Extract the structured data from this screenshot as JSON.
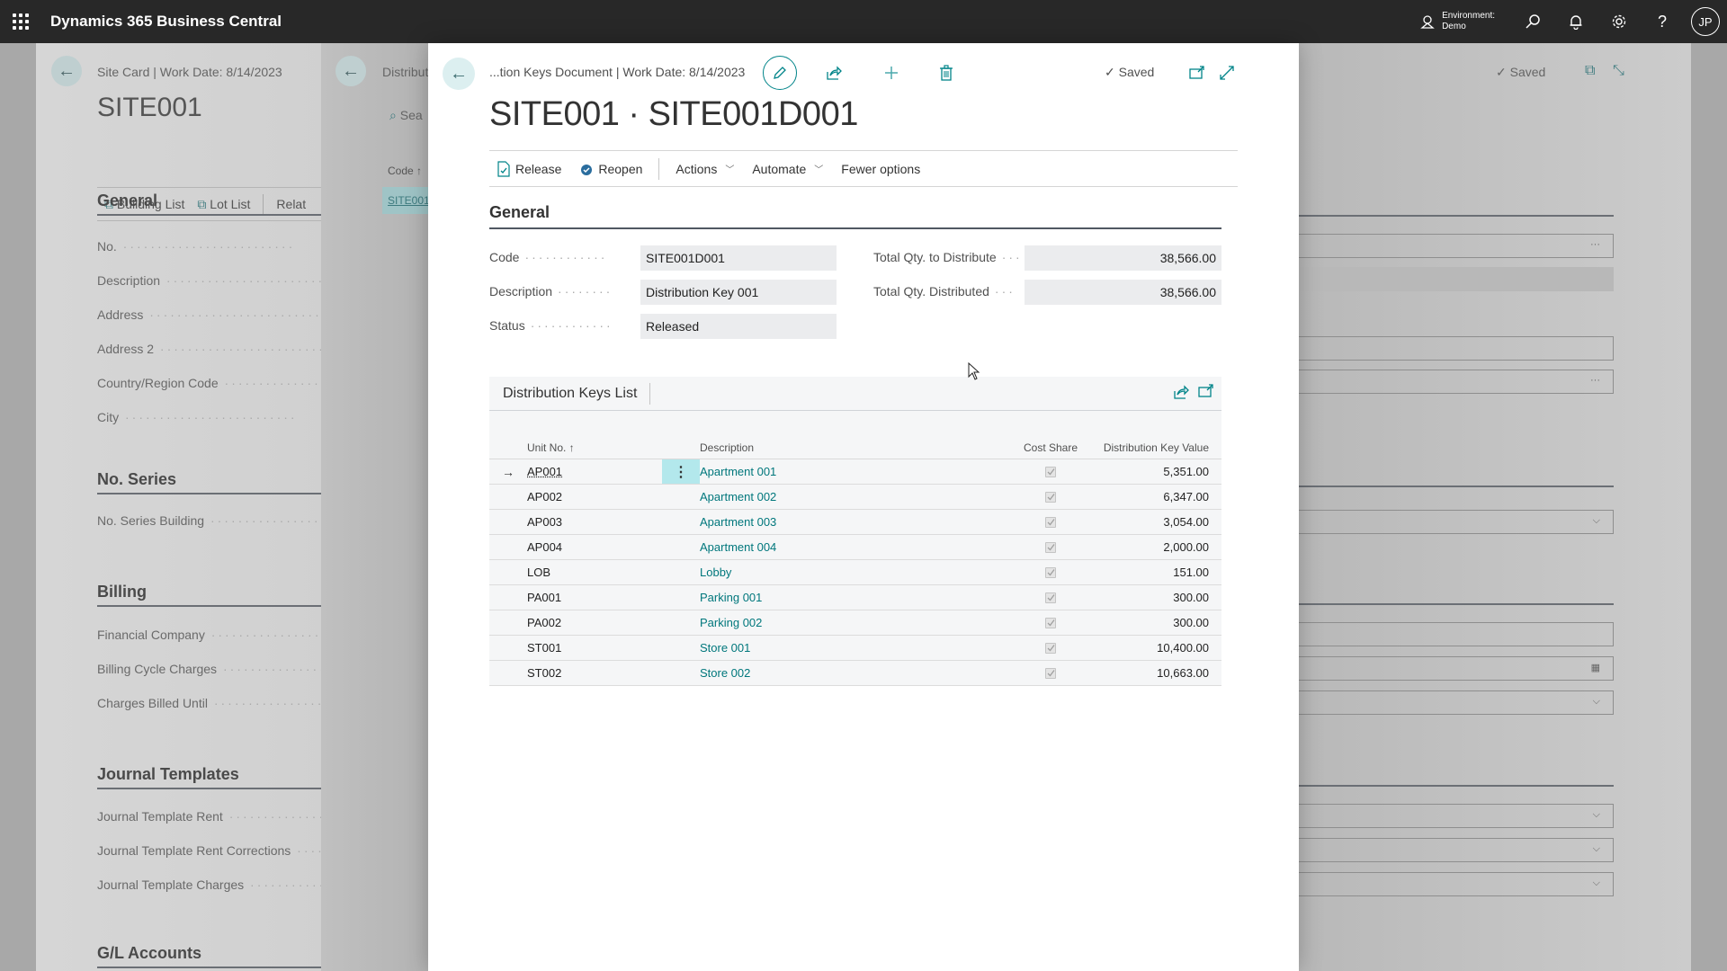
{
  "topbar": {
    "app_title": "Dynamics 365 Business Central",
    "environment_label": "Environment:",
    "environment_value": "Demo",
    "avatar_initials": "JP"
  },
  "bg_site_card": {
    "caption": "Site Card | Work Date: 8/14/2023",
    "title": "SITE001",
    "actions": [
      "Building List",
      "Lot List",
      "Relat"
    ],
    "sections": [
      {
        "title": "General",
        "fields": [
          "No.",
          "Description",
          "Address",
          "Address 2",
          "Country/Region Code",
          "City"
        ]
      },
      {
        "title": "No. Series",
        "fields": [
          "No. Series Building"
        ]
      },
      {
        "title": "Billing",
        "fields": [
          "Financial Company",
          "Billing Cycle Charges",
          "Charges Billed Until"
        ]
      },
      {
        "title": "Journal Templates",
        "fields": [
          "Journal Template Rent",
          "Journal Template Rent Corrections",
          "Journal Template Charges"
        ]
      },
      {
        "title": "G/L Accounts",
        "fields": []
      }
    ],
    "saved_label": "Saved"
  },
  "bg_distribution_list": {
    "caption": "Distribut",
    "search_placeholder": "Sea",
    "code_header": "Code ↑",
    "code_cell": "SITE001"
  },
  "dialog": {
    "caption": "...tion Keys Document | Work Date: 8/14/2023",
    "saved_label": "Saved",
    "title": "SITE001 · SITE001D001",
    "actions": {
      "release": "Release",
      "reopen": "Reopen",
      "actions": "Actions",
      "automate": "Automate",
      "fewer": "Fewer options"
    },
    "general": {
      "title": "General",
      "code_label": "Code",
      "code_value": "SITE001D001",
      "description_label": "Description",
      "description_value": "Distribution Key 001",
      "status_label": "Status",
      "status_value": "Released",
      "total_to_distribute_label": "Total Qty. to Distribute",
      "total_to_distribute_value": "38,566.00",
      "total_distributed_label": "Total Qty. Distributed",
      "total_distributed_value": "38,566.00"
    },
    "list": {
      "title": "Distribution Keys List",
      "columns": {
        "unit_no": "Unit No. ↑",
        "description": "Description",
        "cost_share": "Cost Share",
        "key_value": "Distribution Key Value"
      },
      "rows": [
        {
          "unit": "AP001",
          "description": "Apartment 001",
          "cost_share": true,
          "value": "5,351.00"
        },
        {
          "unit": "AP002",
          "description": "Apartment 002",
          "cost_share": true,
          "value": "6,347.00"
        },
        {
          "unit": "AP003",
          "description": "Apartment 003",
          "cost_share": true,
          "value": "3,054.00"
        },
        {
          "unit": "AP004",
          "description": "Apartment 004",
          "cost_share": true,
          "value": "2,000.00"
        },
        {
          "unit": "LOB",
          "description": "Lobby",
          "cost_share": true,
          "value": "151.00"
        },
        {
          "unit": "PA001",
          "description": "Parking 001",
          "cost_share": true,
          "value": "300.00"
        },
        {
          "unit": "PA002",
          "description": "Parking 002",
          "cost_share": true,
          "value": "300.00"
        },
        {
          "unit": "ST001",
          "description": "Store 001",
          "cost_share": true,
          "value": "10,400.00"
        },
        {
          "unit": "ST002",
          "description": "Store 002",
          "cost_share": true,
          "value": "10,663.00"
        }
      ]
    }
  },
  "colors": {
    "accent": "#008489",
    "topbar": "#282828",
    "link": "#00777c",
    "selected_cell": "#b3e8ec"
  }
}
